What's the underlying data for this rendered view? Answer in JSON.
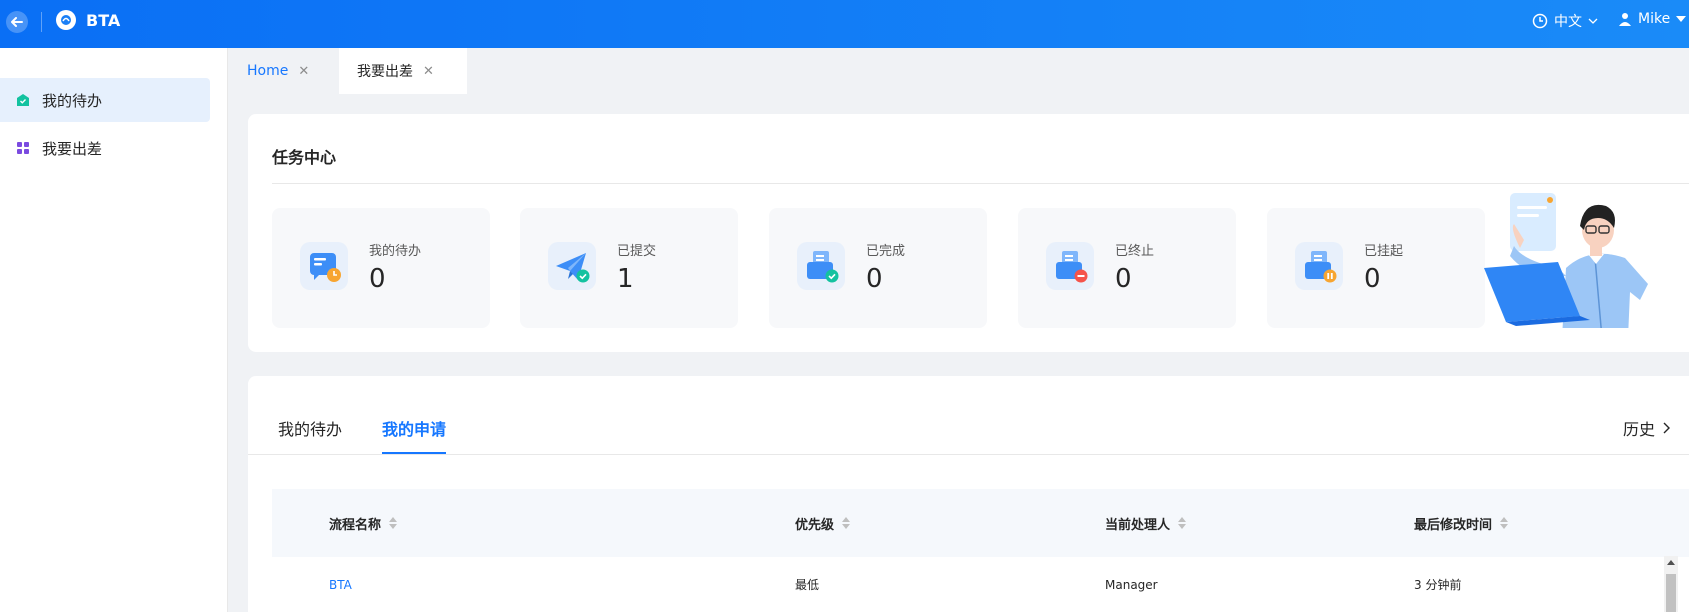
{
  "header": {
    "app_title": "BTA",
    "language": "中文",
    "user": "Mike"
  },
  "sidebar": {
    "items": [
      {
        "label": "我的待办",
        "icon": "home-shield-icon",
        "active": true
      },
      {
        "label": "我要出差",
        "icon": "grid-apps-icon",
        "active": false
      }
    ]
  },
  "tabs": [
    {
      "label": "Home",
      "active": true
    },
    {
      "label": "我要出差",
      "active": false
    }
  ],
  "task_center": {
    "title": "任务中心",
    "stats": [
      {
        "label": "我的待办",
        "value": "0",
        "icon": "todo-clock-icon"
      },
      {
        "label": "已提交",
        "value": "1",
        "icon": "submitted-plane-icon"
      },
      {
        "label": "已完成",
        "value": "0",
        "icon": "completed-check-icon"
      },
      {
        "label": "已终止",
        "value": "0",
        "icon": "terminated-minus-icon"
      },
      {
        "label": "已挂起",
        "value": "0",
        "icon": "suspended-pause-icon"
      }
    ]
  },
  "list_tabs": [
    {
      "label": "我的待办",
      "active": false
    },
    {
      "label": "我的申请",
      "active": true
    }
  ],
  "history_label": "历史",
  "table": {
    "columns": [
      "流程名称",
      "优先级",
      "当前处理人",
      "最后修改时间"
    ],
    "rows": [
      [
        "BTA",
        "最低",
        "Manager",
        "3 分钟前"
      ]
    ]
  },
  "colors": {
    "primary": "#1677ff",
    "header_start": "#0a6ff5",
    "header_end": "#1a8bf8"
  }
}
